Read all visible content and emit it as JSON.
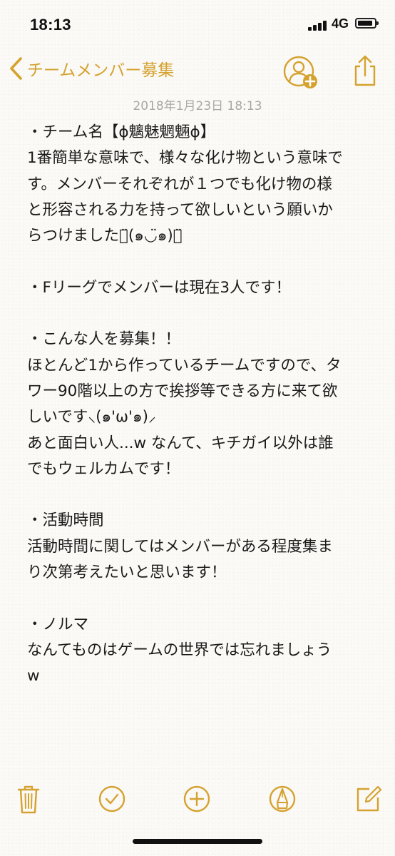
{
  "status_bar": {
    "time": "18:13",
    "network": "4G"
  },
  "nav": {
    "back_label": "チームメンバー募集",
    "icons": {
      "back": "chevron-left-icon",
      "add_person": "person-add-icon",
      "share": "share-icon"
    }
  },
  "note": {
    "date": "2018年1月23日 18:13",
    "lines": [
      "・チーム名【ɸ魑魅魍魎ɸ】",
      "1番簡単な意味で、様々な化け物という意味で",
      "す。メンバーそれぞれが１つでも化け物の様",
      "と形容される力を持って欲しいという願いか",
      "らつけましたｅ̈(๑◡̈๑)ｓ̈",
      "",
      "・Fリーグでメンバーは現在3人です！",
      "",
      "・こんな人を募集！！",
      "ほとんど1から作っているチームですので、タ",
      "ワー90階以上の方で挨拶等できる方に来て欲",
      "しいです⸜(๑'ω'๑)⸝",
      "あと面白い人...w なんて、キチガイ以外は誰",
      "でもウェルカムです！",
      "",
      "・活動時間",
      "活動時間に関してはメンバーがある程度集ま",
      "り次第考えたいと思います！",
      "",
      "・ノルマ",
      "なんてものはゲームの世界では忘れましょう",
      "w"
    ]
  },
  "toolbar": {
    "icons": [
      "trash-icon",
      "checklist-icon",
      "add-icon",
      "markup-pen-icon",
      "compose-icon"
    ]
  },
  "colors": {
    "accent": "#d5a230",
    "date_gray": "#a8a8a8",
    "text": "#1a1a1a",
    "paper": "#fbfaf6"
  }
}
